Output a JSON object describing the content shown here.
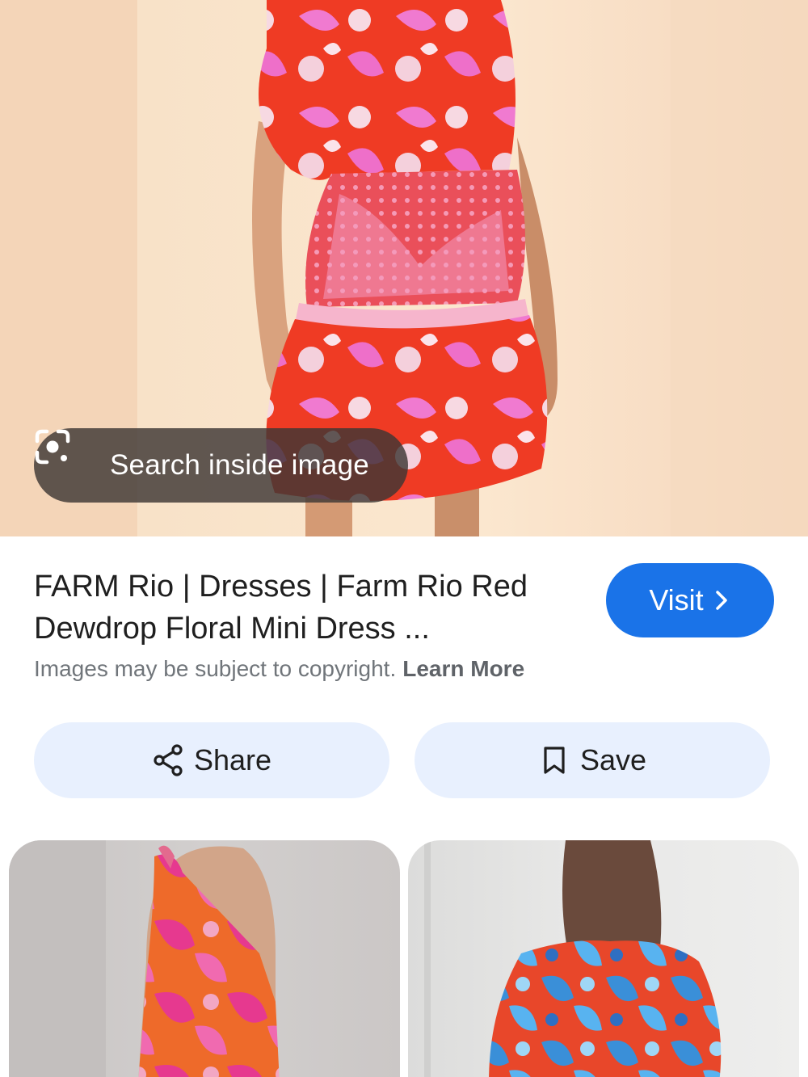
{
  "hero": {
    "image_description_icon": "product-photo",
    "lens_button_label": "Search inside image",
    "lens_icon": "google-lens-icon"
  },
  "result": {
    "title": "FARM Rio | Dresses | Farm Rio Red Dewdrop Floral Mini Dress ...",
    "visit_label": "Visit",
    "visit_icon": "chevron-right-icon",
    "copyright_text": "Images may be subject to copyright.",
    "learn_more_label": "Learn More"
  },
  "actions": {
    "share_label": "Share",
    "share_icon": "share-icon",
    "save_label": "Save",
    "save_icon": "bookmark-icon"
  },
  "colors": {
    "accent": "#1a73e8",
    "action_bg": "#e8f0fe",
    "text_primary": "#1f1f1f",
    "text_secondary": "#70757a"
  }
}
